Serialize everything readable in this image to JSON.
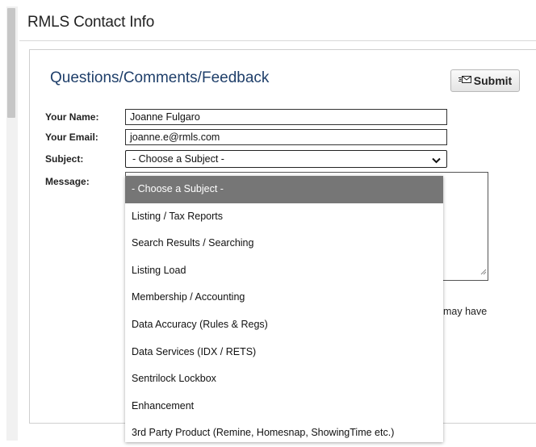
{
  "page": {
    "title": "RMLS Contact Info"
  },
  "form": {
    "heading": "Questions/Comments/Feedback",
    "submit_label": "Submit",
    "name_label": "Your Name:",
    "name_value": "Joanne Fulgaro",
    "email_label": "Your Email:",
    "email_value": "joanne.e@rmls.com",
    "subject_label": "Subject:",
    "subject_value": "- Choose a Subject -",
    "message_label": "Message:",
    "note_fragment": "may have"
  },
  "dropdown": {
    "options": [
      "- Choose a Subject -",
      "Listing / Tax Reports",
      "Search Results / Searching",
      "Listing Load",
      "Membership / Accounting",
      "Data Accuracy (Rules & Regs)",
      "Data Services (IDX / RETS)",
      "Sentrilock Lockbox",
      "Enhancement",
      "3rd Party Product (Remine, Homesnap, ShowingTime etc.)"
    ],
    "selected_index": 0
  },
  "icons": {
    "submit": "envelope-icon",
    "select": "chevron-down-icon"
  },
  "colors": {
    "heading": "#1f3f6a",
    "selected_option_bg": "#767676"
  }
}
